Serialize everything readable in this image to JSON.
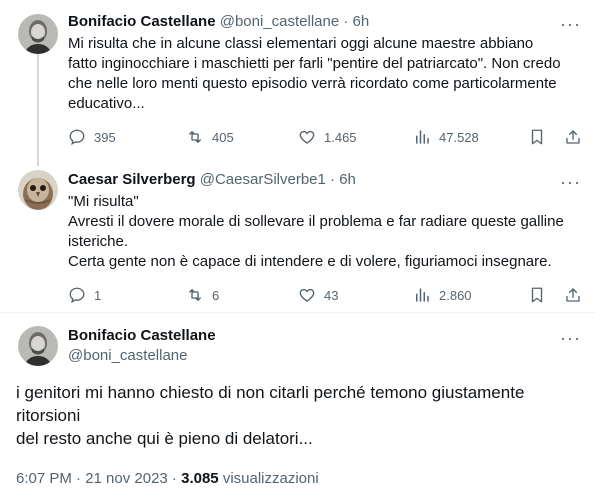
{
  "tweets": [
    {
      "name": "Bonifacio Castellane",
      "handle": "@boni_castellane",
      "time": "· 6h",
      "text": [
        "Mi risulta che in alcune classi elementari oggi alcune maestre abbiano",
        "fatto inginocchiare i maschietti per farli \"pentire del patriarcato\". Non credo",
        "che nelle loro menti questo episodio verrà ricordato come particolarmente",
        "educativo..."
      ],
      "replies": "395",
      "retweets": "405",
      "likes": "1.465",
      "views": "47.528"
    },
    {
      "name": "Caesar Silverberg",
      "handle": "@CaesarSilverbe1",
      "time": "· 6h",
      "text": [
        "\"Mi risulta\"",
        "Avresti il dovere morale di sollevare il problema e far radiare queste galline",
        "isteriche.",
        "Certa gente non è capace di intendere e di volere, figuriamoci insegnare."
      ],
      "replies": "1",
      "retweets": "6",
      "likes": "43",
      "views": "2.860"
    }
  ],
  "main": {
    "name": "Bonifacio Castellane",
    "handle": "@boni_castellane",
    "text": [
      "i genitori mi hanno chiesto di non citarli perché temono giustamente",
      "ritorsioni",
      "del resto anche qui è pieno di delatori..."
    ],
    "time": "6:07 PM · 21 nov 2023 · ",
    "views_count": "3.085",
    "views_label": " visualizzazioni"
  },
  "colors": {
    "text": "#0f1419",
    "secondary": "#536471",
    "thread_line": "#cfd9de"
  }
}
